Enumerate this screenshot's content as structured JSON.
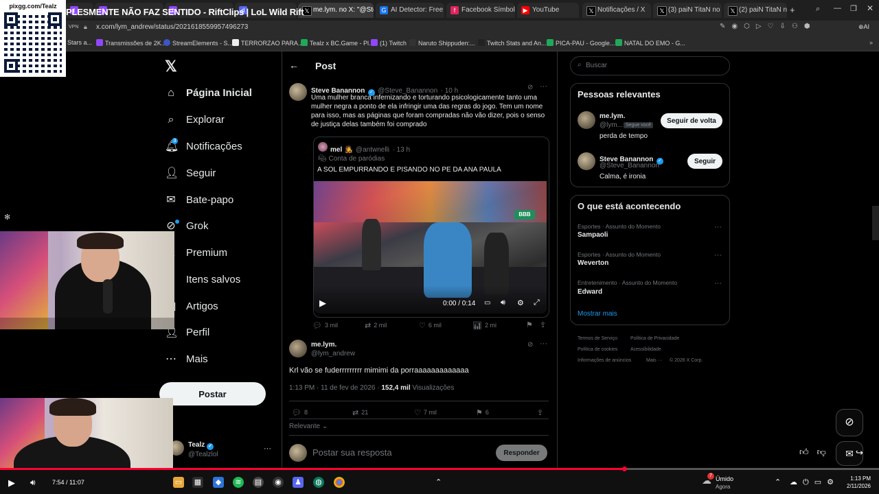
{
  "browser": {
    "stream_title": "PLESMENTE NÃO FAZ SENTIDO - RiftClips | LoL Wild Rift",
    "url": "x.com/lym_andrew/status/2021618559957496273",
    "vpn_label": "VPN",
    "tabs": [
      {
        "label": "me.lym. no X: \"@Stev",
        "icon": "x-icon"
      },
      {
        "label": "AI Detector: Free AI",
        "icon": "google-icon"
      },
      {
        "label": "Facebook Símbolos",
        "icon": "facebook-icon"
      },
      {
        "label": "YouTube",
        "icon": "youtube-icon"
      },
      {
        "label": "Notificações / X",
        "icon": "x-icon"
      },
      {
        "label": "(3) paiN TitaN no X:",
        "icon": "x-icon"
      },
      {
        "label": "(2) paiN TitaN no X:",
        "icon": "x-icon"
      }
    ],
    "bookmarks": [
      {
        "label": "Stars a..."
      },
      {
        "label": "Transmissões de 2K..."
      },
      {
        "label": "StreamElements - S..."
      },
      {
        "label": "TERRORZAO PARA..."
      },
      {
        "label": "Tealz x BC.Game - Pl..."
      },
      {
        "label": "(1) Twitch"
      },
      {
        "label": "Naruto Shippuden:..."
      },
      {
        "label": "Twitch Stats and An..."
      },
      {
        "label": "PICA-PAU - Google..."
      },
      {
        "label": "NATAL DO EMO - G..."
      }
    ]
  },
  "overlay": {
    "qr_label": "pixgg.com/Tealz"
  },
  "sidebar": {
    "items": [
      {
        "label": "Página Inicial",
        "icon": "home-icon"
      },
      {
        "label": "Explorar",
        "icon": "search-icon"
      },
      {
        "label": "Notificações",
        "icon": "bell-icon"
      },
      {
        "label": "Seguir",
        "icon": "follow-icon"
      },
      {
        "label": "Bate-papo",
        "icon": "mail-icon"
      },
      {
        "label": "Grok",
        "icon": "grok-icon"
      },
      {
        "label": "Premium",
        "icon": "x-premium-icon"
      },
      {
        "label": "Itens salvos",
        "icon": "bookmark-icon"
      },
      {
        "label": "Artigos",
        "icon": "articles-icon"
      },
      {
        "label": "Perfil",
        "icon": "profile-icon"
      },
      {
        "label": "Mais",
        "icon": "more-icon"
      }
    ],
    "notif_count": "3",
    "post_button": "Postar",
    "account": {
      "name": "Tealz",
      "handle": "@Tealzlol"
    }
  },
  "main": {
    "header": "Post",
    "parent_post": {
      "name": "Steve Banannon",
      "handle": "@Steve_Banannon",
      "time": "· 10 h",
      "text": "Uma mulher branca infernizando e torturando psicologicamente tanto uma mulher negra a ponto de ela infringir uma das regras do jogo. Tem um nome para isso, mas as páginas que foram compradas não vão dizer, pois o senso de justiça delas também foi comprado",
      "quote": {
        "name": "mel 🧑‍🎤",
        "handle": "@antwnelli",
        "time": "· 13 h",
        "parody": "Conta de paródias",
        "text": "A SOL EMPURRANDO E PISANDO NO PE DA ANA PAULA",
        "video_time": "0:00 / 0:14",
        "bbb_logo": "BBB"
      },
      "stats": {
        "replies": "3 mil",
        "reposts": "2 mil",
        "likes": "6 mil",
        "views": "2 mi"
      }
    },
    "reply": {
      "name": "me.lym.",
      "handle": "@lym_andrew",
      "text": "Krl vão se fuderrrrrrrrr mimimi da porraaaaaaaaaaaaa",
      "timestamp": "1:13 PM · 11 de fev de 2026 ·",
      "views_count": "152,4 mil",
      "views_label": "Visualizações",
      "stats": {
        "replies": "8",
        "reposts": "21",
        "likes": "7 mil",
        "bookmarks": "6"
      }
    },
    "sort_label": "Relevante",
    "composer_placeholder": "Postar sua resposta",
    "reply_button": "Responder"
  },
  "right": {
    "search_placeholder": "Buscar",
    "relevant_title": "Pessoas relevantes",
    "people": [
      {
        "name": "me.lym.",
        "handle": "@lym...",
        "badge": "Segue você",
        "bio": "perda de tempo",
        "button": "Seguir de volta"
      },
      {
        "name": "Steve Banannon",
        "handle": "@Steve_Banannon",
        "bio": "Calma, é ironia",
        "button": "Seguir"
      }
    ],
    "trends_title": "O que está acontecendo",
    "trends": [
      {
        "category": "Esportes · Assunto do Momento",
        "name": "Sampaoli"
      },
      {
        "category": "Esportes · Assunto do Momento",
        "name": "Weverton"
      },
      {
        "category": "Entretenimento · Assunto do Momento",
        "name": "Edward"
      }
    ],
    "show_more": "Mostrar mais",
    "footer": [
      "Termos de Serviço",
      "Política de Privacidade",
      "Política de cookies",
      "Acessibilidade",
      "Informações de anúncios",
      "Mais ···",
      "© 2026 X Corp."
    ]
  },
  "player": {
    "time": "7:54 / 11:07",
    "progress": 0.71,
    "weather": {
      "label": "Úmido",
      "sub": "Agora",
      "badge": "7"
    },
    "clock": {
      "time": "1:13 PM",
      "date": "2/11/2026"
    }
  },
  "colors": {
    "accent": "#1d9bf0",
    "progress": "#ff0033",
    "bg": "#000000"
  }
}
